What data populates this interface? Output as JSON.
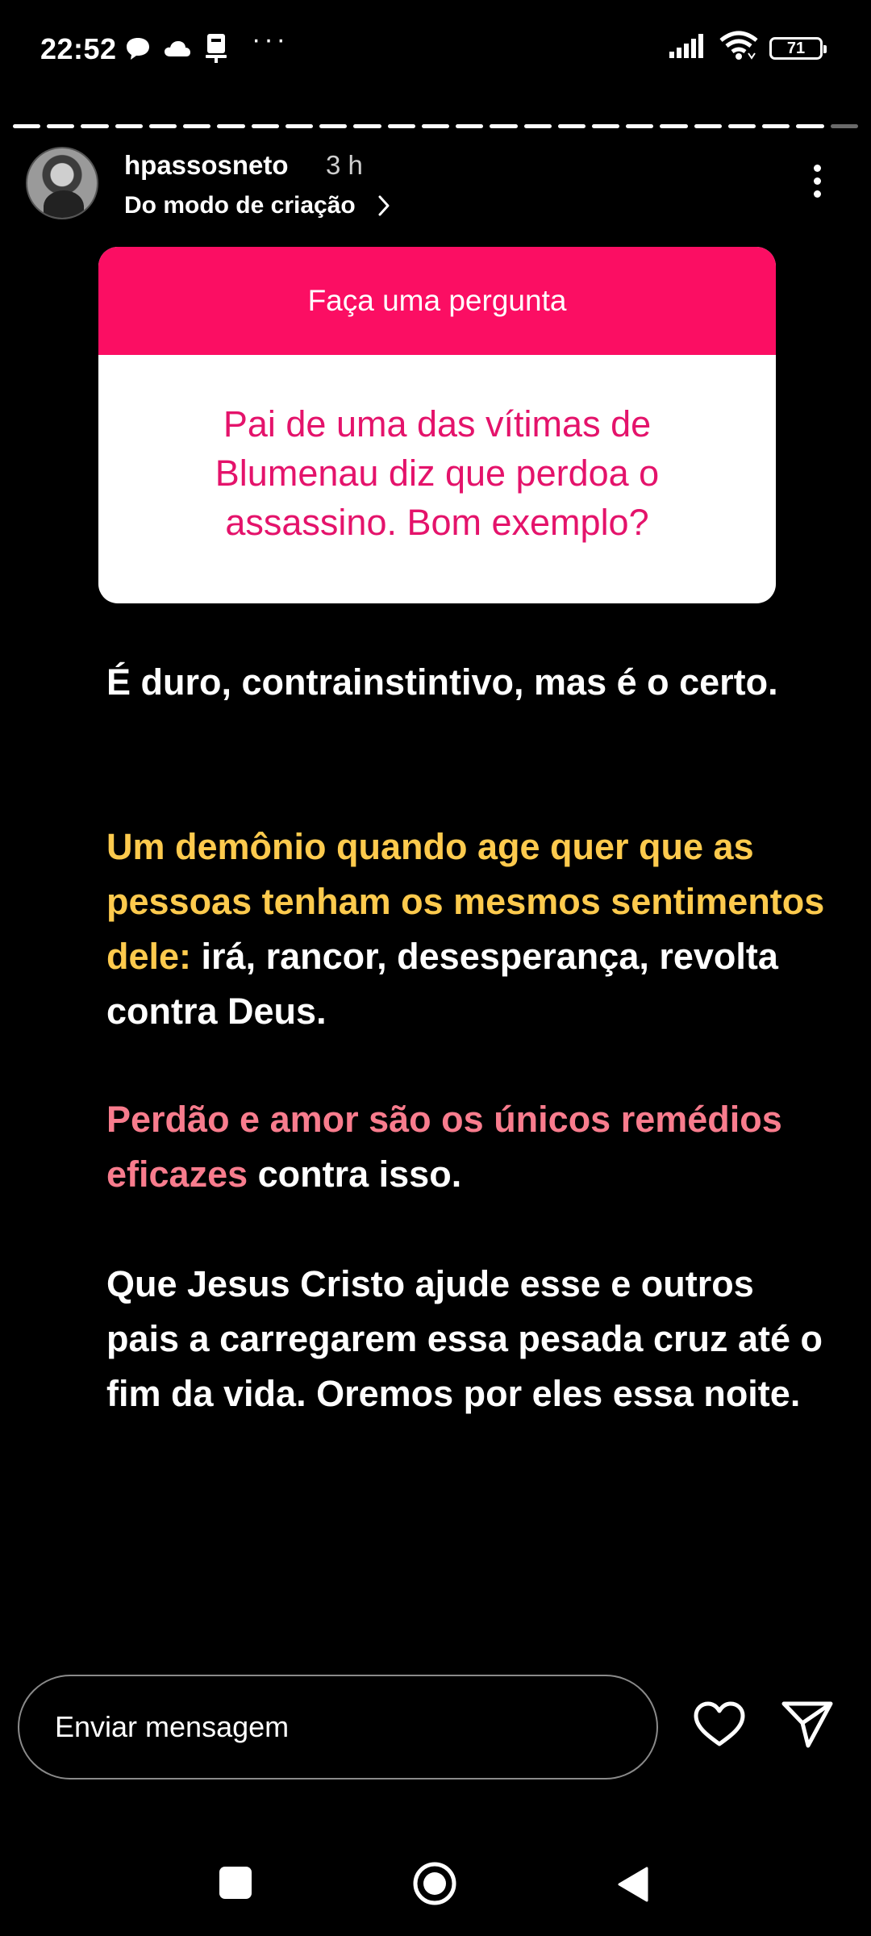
{
  "status_bar": {
    "time": "22:52",
    "more_indicator": "···",
    "battery": "71"
  },
  "story": {
    "username": "hpassosneto",
    "time_ago": "3 h",
    "subtitle": "Do modo de criação",
    "progress": {
      "segments": 25,
      "viewed": 24
    }
  },
  "question": {
    "header": "Faça uma pergunta",
    "text": "Pai de uma das vítimas de Blumenau diz que perdoa o assassino. Bom exemplo?"
  },
  "body": {
    "p1": "É duro, contrainstintivo, mas é o certo.",
    "p2_highlight": "Um demônio quando age quer que as pessoas tenham os mesmos sentimentos dele:",
    "p2_rest": " irá, rancor, desesperança, revolta contra Deus.",
    "p3_highlight": "Perdão e amor são os únicos remédios eficazes",
    "p3_rest": " contra isso.",
    "p4": "Que Jesus Cristo ajude esse e outros pais a carregarem essa pesada cruz até o fim da vida. Oremos por eles essa noite."
  },
  "message_bar": {
    "placeholder": "Enviar mensagem"
  },
  "colors": {
    "question_header": "#fb0e63",
    "question_text": "#e4136b",
    "highlight_yellow": "#fdca4d",
    "highlight_pink": "#f87c8d"
  }
}
